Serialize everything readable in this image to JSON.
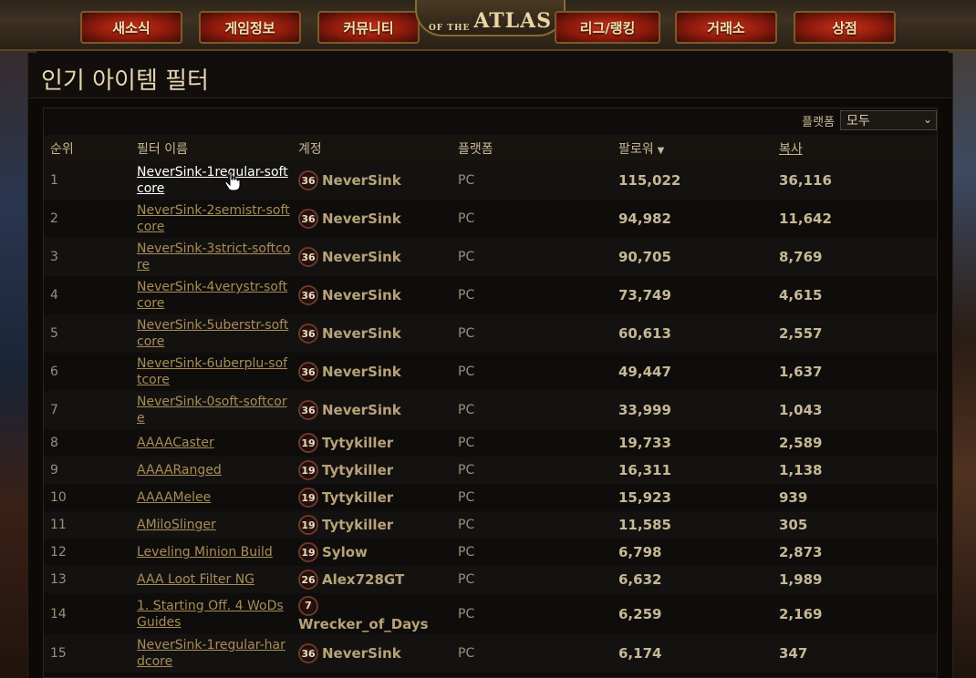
{
  "nav": {
    "items": [
      "새소식",
      "게임정보",
      "커뮤니티",
      "리그/랭킹",
      "거래소",
      "상점"
    ],
    "logo_small": "OF THE",
    "logo_text": "ATLAS"
  },
  "page_title": "인기 아이템 필터",
  "platform_filter": {
    "label": "플랫폼",
    "selected": "모두"
  },
  "columns": {
    "rank": "순위",
    "name": "필터 이름",
    "account": "계정",
    "platform": "플랫폼",
    "followers": "팔로워",
    "copies": "복사"
  },
  "rows": [
    {
      "rank": "1",
      "name": "NeverSink-1regular-softcore",
      "level": "36",
      "account": "NeverSink",
      "platform": "PC",
      "followers": "115,022",
      "copies": "36,116"
    },
    {
      "rank": "2",
      "name": "NeverSink-2semistr-softcore",
      "level": "36",
      "account": "NeverSink",
      "platform": "PC",
      "followers": "94,982",
      "copies": "11,642"
    },
    {
      "rank": "3",
      "name": "NeverSink-3strict-softcore",
      "level": "36",
      "account": "NeverSink",
      "platform": "PC",
      "followers": "90,705",
      "copies": "8,769"
    },
    {
      "rank": "4",
      "name": "NeverSink-4verystr-softcore",
      "level": "36",
      "account": "NeverSink",
      "platform": "PC",
      "followers": "73,749",
      "copies": "4,615"
    },
    {
      "rank": "5",
      "name": "NeverSink-5uberstr-softcore",
      "level": "36",
      "account": "NeverSink",
      "platform": "PC",
      "followers": "60,613",
      "copies": "2,557"
    },
    {
      "rank": "6",
      "name": "NeverSink-6uberplu-softcore",
      "level": "36",
      "account": "NeverSink",
      "platform": "PC",
      "followers": "49,447",
      "copies": "1,637"
    },
    {
      "rank": "7",
      "name": "NeverSink-0soft-softcore",
      "level": "36",
      "account": "NeverSink",
      "platform": "PC",
      "followers": "33,999",
      "copies": "1,043"
    },
    {
      "rank": "8",
      "name": "AAAACaster",
      "level": "19",
      "account": "Tytykiller",
      "platform": "PC",
      "followers": "19,733",
      "copies": "2,589"
    },
    {
      "rank": "9",
      "name": "AAAARanged",
      "level": "19",
      "account": "Tytykiller",
      "platform": "PC",
      "followers": "16,311",
      "copies": "1,138"
    },
    {
      "rank": "10",
      "name": "AAAAMelee",
      "level": "19",
      "account": "Tytykiller",
      "platform": "PC",
      "followers": "15,923",
      "copies": "939"
    },
    {
      "rank": "11",
      "name": "AMiloSlinger",
      "level": "19",
      "account": "Tytykiller",
      "platform": "PC",
      "followers": "11,585",
      "copies": "305"
    },
    {
      "rank": "12",
      "name": "Leveling Minion Build",
      "level": "19",
      "account": "Sylow",
      "platform": "PC",
      "followers": "6,798",
      "copies": "2,873"
    },
    {
      "rank": "13",
      "name": "AAA Loot Filter NG",
      "level": "26",
      "account": "Alex728GT",
      "platform": "PC",
      "followers": "6,632",
      "copies": "1,989"
    },
    {
      "rank": "14",
      "name": "1. Starting Off. 4 WoDs Guides",
      "level": "7",
      "account": "Wrecker_of_Days",
      "platform": "PC",
      "followers": "6,259",
      "copies": "2,169"
    },
    {
      "rank": "15",
      "name": "NeverSink-1regular-hardcore",
      "level": "36",
      "account": "NeverSink",
      "platform": "PC",
      "followers": "6,174",
      "copies": "347"
    }
  ]
}
